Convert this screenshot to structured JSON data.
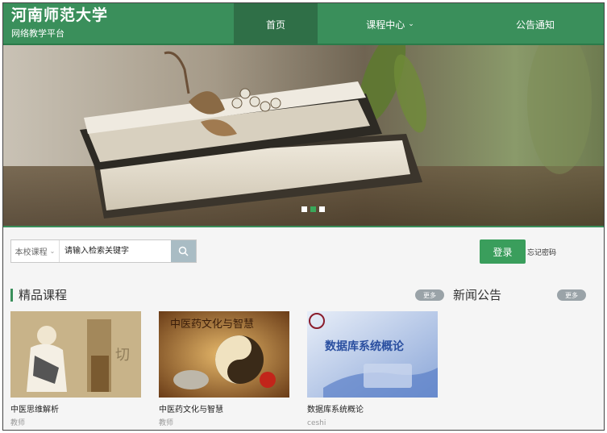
{
  "site": {
    "title": "河南师范大学",
    "subtitle": "网络教学平台"
  },
  "nav": {
    "items": [
      {
        "label": "首页",
        "active": true
      },
      {
        "label": "课程中心",
        "has_dropdown": true
      },
      {
        "label": "公告通知"
      }
    ]
  },
  "banner": {
    "slides": 3,
    "active_slide": 2
  },
  "search": {
    "scope": "本校课程",
    "placeholder": "请输入检索关键字"
  },
  "auth": {
    "login_label": "登录",
    "forgot_label": "忘记密码"
  },
  "featured": {
    "title": "精品课程",
    "more_label": "更多",
    "courses": [
      {
        "name": "中医思维解析",
        "teacher": "教师"
      },
      {
        "name": "中医药文化与智慧",
        "teacher": "教师",
        "thumb_text": "中医药文化与智慧"
      },
      {
        "name": "数据库系统概论",
        "teacher": "ceshi",
        "thumb_text": "数据库系统概论"
      }
    ]
  },
  "news": {
    "title": "新闻公告",
    "more_label": "更多"
  },
  "colors": {
    "brand_green": "#3a8f5b",
    "nav_active": "#2f6f47",
    "login_green": "#3a9e5c"
  }
}
